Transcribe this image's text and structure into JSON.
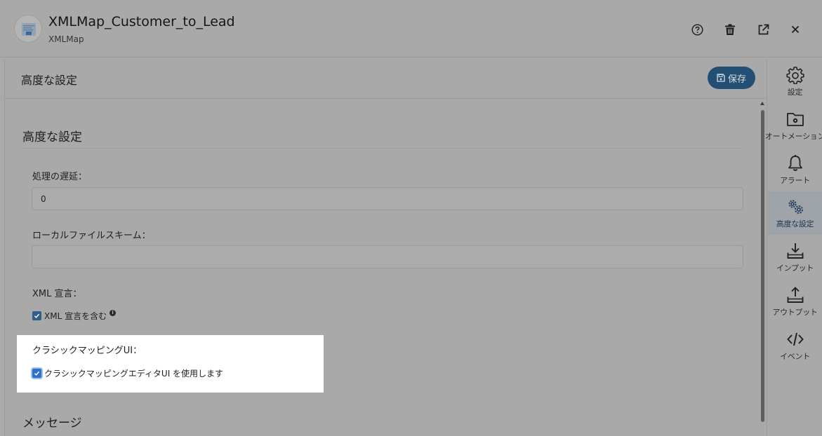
{
  "header": {
    "title": "XMLMap_Customer_to_Lead",
    "subtitle": "XMLMap",
    "app_icon": "xml-map-document-icon",
    "actions": [
      {
        "name": "help",
        "icon": "question-circle-icon"
      },
      {
        "name": "delete",
        "icon": "trash-icon"
      },
      {
        "name": "open-external",
        "icon": "external-link-icon"
      },
      {
        "name": "close",
        "icon": "close-icon"
      }
    ]
  },
  "main": {
    "title": "高度な設定",
    "save_label": "保存",
    "section_title": "高度な設定",
    "fields": {
      "processing_delay": {
        "label": "処理の遅延：",
        "value": "0"
      },
      "local_file_scheme": {
        "label": "ローカルファイルスキーム：",
        "value": ""
      },
      "xml_declaration": {
        "label": "XML 宣言：",
        "checkbox_label": "XML 宣言を含む",
        "checked": true
      },
      "classic_mapping": {
        "label": "クラシックマッピングUI：",
        "checkbox_label": "クラシックマッピングエディタUI を使用します",
        "checked": true
      }
    },
    "messages_title": "メッセージ"
  },
  "sidebar": {
    "items": [
      {
        "label": "設定",
        "icon": "gear-icon",
        "active": false
      },
      {
        "label": "オートメーション",
        "icon": "folder-gear-icon",
        "active": false
      },
      {
        "label": "アラート",
        "icon": "bell-icon",
        "active": false
      },
      {
        "label": "高度な設定",
        "icon": "gears-icon",
        "active": true
      },
      {
        "label": "インプット",
        "icon": "download-icon",
        "active": false
      },
      {
        "label": "アウトプット",
        "icon": "upload-icon",
        "active": false
      },
      {
        "label": "イベント",
        "icon": "code-icon",
        "active": false
      }
    ]
  },
  "colors": {
    "overlay_gray": "#a9a9a9",
    "save_button": "#234f74",
    "active_sidebar": "#1e3650",
    "highlight": "#ffffff"
  }
}
